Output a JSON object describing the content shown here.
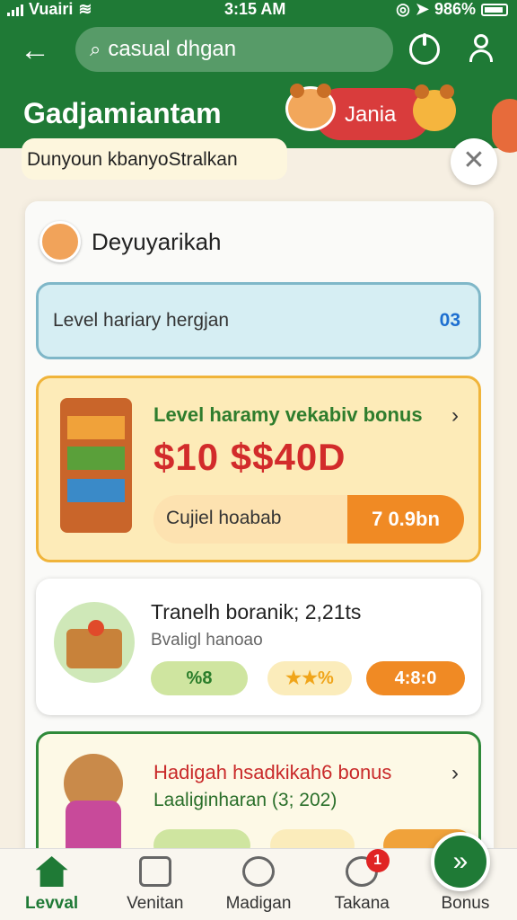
{
  "status_bar": {
    "carrier": "Vuairi",
    "time": "3:15 AM",
    "battery": "986%"
  },
  "header": {
    "search_value": "casual dhgan",
    "app_title": "Gadjamiantam",
    "pill_label": "Jania"
  },
  "subtitle": "Dunyoun kbanyoStralkan",
  "sheet": {
    "title": "Deyuyarikah",
    "blue_card": {
      "label": "Level hariary hergjan",
      "value": "03"
    },
    "feature_card": {
      "title": "Level haramy vekabiv bonus",
      "amount": "$10 $$40D",
      "bar_label": "Cujiel hoabab",
      "bar_value": "7 0.9bn"
    },
    "gift_card": {
      "title": "Tranelh boranik; 2,21ts",
      "subtitle": "Bvaligl hanoao",
      "chips": [
        "%8",
        "★★%",
        "4:8:0"
      ]
    },
    "bear_card": {
      "title": "Hadigah hsadkikah6 bonus",
      "subtitle": "Laaliginharan (3; 202)"
    }
  },
  "bottom_nav": {
    "items": [
      {
        "label": "Levval"
      },
      {
        "label": "Venitan"
      },
      {
        "label": "Madigan"
      },
      {
        "label": "Takana",
        "badge": "1"
      },
      {
        "label": "Bonus"
      }
    ]
  },
  "colors": {
    "brand_green": "#1f7a36",
    "accent_orange": "#f08a24",
    "alert_red": "#d22b2b"
  }
}
